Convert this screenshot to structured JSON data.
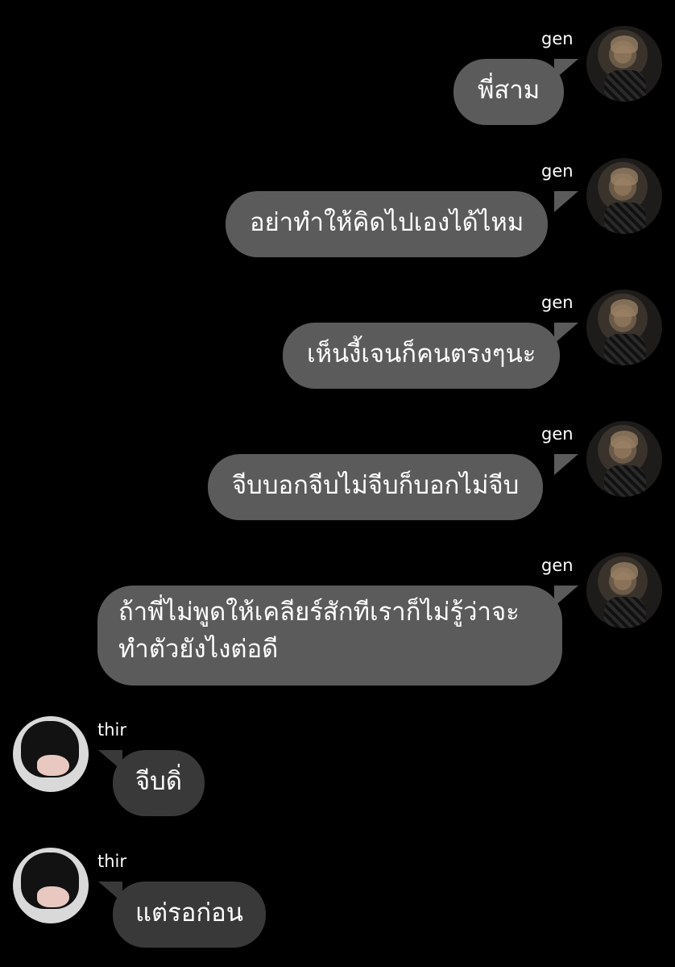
{
  "messages": [
    {
      "sender": "gen",
      "text": "พี่สาม"
    },
    {
      "sender": "gen",
      "text": "อย่าทำให้คิดไปเองได้ไหม"
    },
    {
      "sender": "gen",
      "text": "เห็นงี้เจนก็คนตรงๆนะ"
    },
    {
      "sender": "gen",
      "text": "จีบบอกจีบไม่จีบก็บอกไม่จีบ"
    },
    {
      "sender": "gen",
      "text": "ถ้าพี่ไม่พูดให้เคลียร์สักทีเราก็ไม่รู้ว่าจะทำตัวยังไงต่อดี"
    },
    {
      "sender": "thir",
      "text": "จีบดิ่"
    },
    {
      "sender": "thir",
      "text": "แต่รอก่อน"
    }
  ],
  "colors": {
    "background": "#000000",
    "outgoing_bubble": "#5b5b5b",
    "incoming_bubble": "#393939",
    "text": "#ffffff"
  }
}
